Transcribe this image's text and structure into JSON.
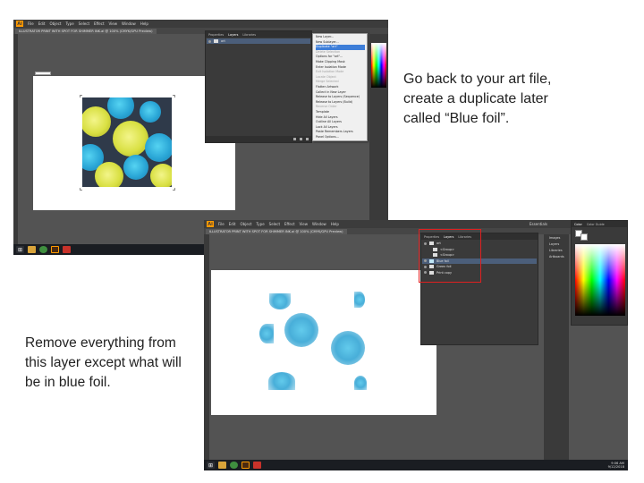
{
  "captions": {
    "top_lines": [
      "Go back to your art file,",
      "create a duplicate later",
      "called “Blue foil”."
    ],
    "bottom_lines": [
      "Remove everything from",
      "this layer except what will",
      "be in blue foil."
    ]
  },
  "app": {
    "logo": "Ai",
    "menu": [
      "File",
      "Edit",
      "Object",
      "Type",
      "Select",
      "Effect",
      "View",
      "Window",
      "Help"
    ]
  },
  "screenshot1": {
    "document_tab": "ILLUSTRATOR PRINT WITH SPOT FOR SHIMMER INK.ai @ 100% (CMYK/GPU Preview)",
    "panel_tabs": [
      "Properties",
      "Layers",
      "Libraries"
    ],
    "layer_name": "art",
    "flyout_items": [
      {
        "label": "New Layer...",
        "state": "normal"
      },
      {
        "label": "New Sublayer...",
        "state": "normal"
      },
      {
        "label": "Duplicate \"art\"",
        "state": "highlighted"
      },
      {
        "label": "Delete Selection",
        "state": "dim"
      },
      {
        "label": "Options for \"art\"...",
        "state": "normal"
      },
      {
        "label": "Make Clipping Mask",
        "state": "normal"
      },
      {
        "label": "Enter Isolation Mode",
        "state": "normal"
      },
      {
        "label": "Exit Isolation Mode",
        "state": "dim"
      },
      {
        "label": "Locate Object",
        "state": "dim"
      },
      {
        "label": "Merge Selected",
        "state": "dim"
      },
      {
        "label": "Flatten Artwork",
        "state": "normal"
      },
      {
        "label": "Collect in New Layer",
        "state": "normal"
      },
      {
        "label": "Release to Layers (Sequence)",
        "state": "normal"
      },
      {
        "label": "Release to Layers (Build)",
        "state": "normal"
      },
      {
        "label": "Reverse Order",
        "state": "dim"
      },
      {
        "label": "Template",
        "state": "normal"
      },
      {
        "label": "Hide All Layers",
        "state": "normal"
      },
      {
        "label": "Outline All Layers",
        "state": "normal"
      },
      {
        "label": "Lock All Layers",
        "state": "normal"
      },
      {
        "label": "Paste Remembers Layers",
        "state": "normal"
      },
      {
        "label": "Panel Options...",
        "state": "normal"
      }
    ]
  },
  "screenshot2": {
    "document_tab": "ILLUSTRATOR PRINT WITH SPOT FOR SHIMMER INK.ai @ 100% (CMYK/GPU Preview)",
    "workspace_label": "Essentials",
    "panel_tabs": [
      "Properties",
      "Layers",
      "Libraries"
    ],
    "layers": [
      "art",
      "<Group>",
      "<Group>",
      "Blue foil",
      "Green foil",
      "Print copy"
    ],
    "side_panel_items": [
      "Images",
      "Layers",
      "Libraries",
      "Artboards"
    ],
    "color_panel_tabs": [
      "Color",
      "Color Guide"
    ],
    "clock_time": "9:06 AM",
    "clock_date": "9/12/2018"
  },
  "colors": {
    "accent_highlight": "#3e7ed8",
    "callout_red": "#e02020",
    "foil_blue": "#2aa6d6",
    "foil_yellow": "#d9e043"
  }
}
